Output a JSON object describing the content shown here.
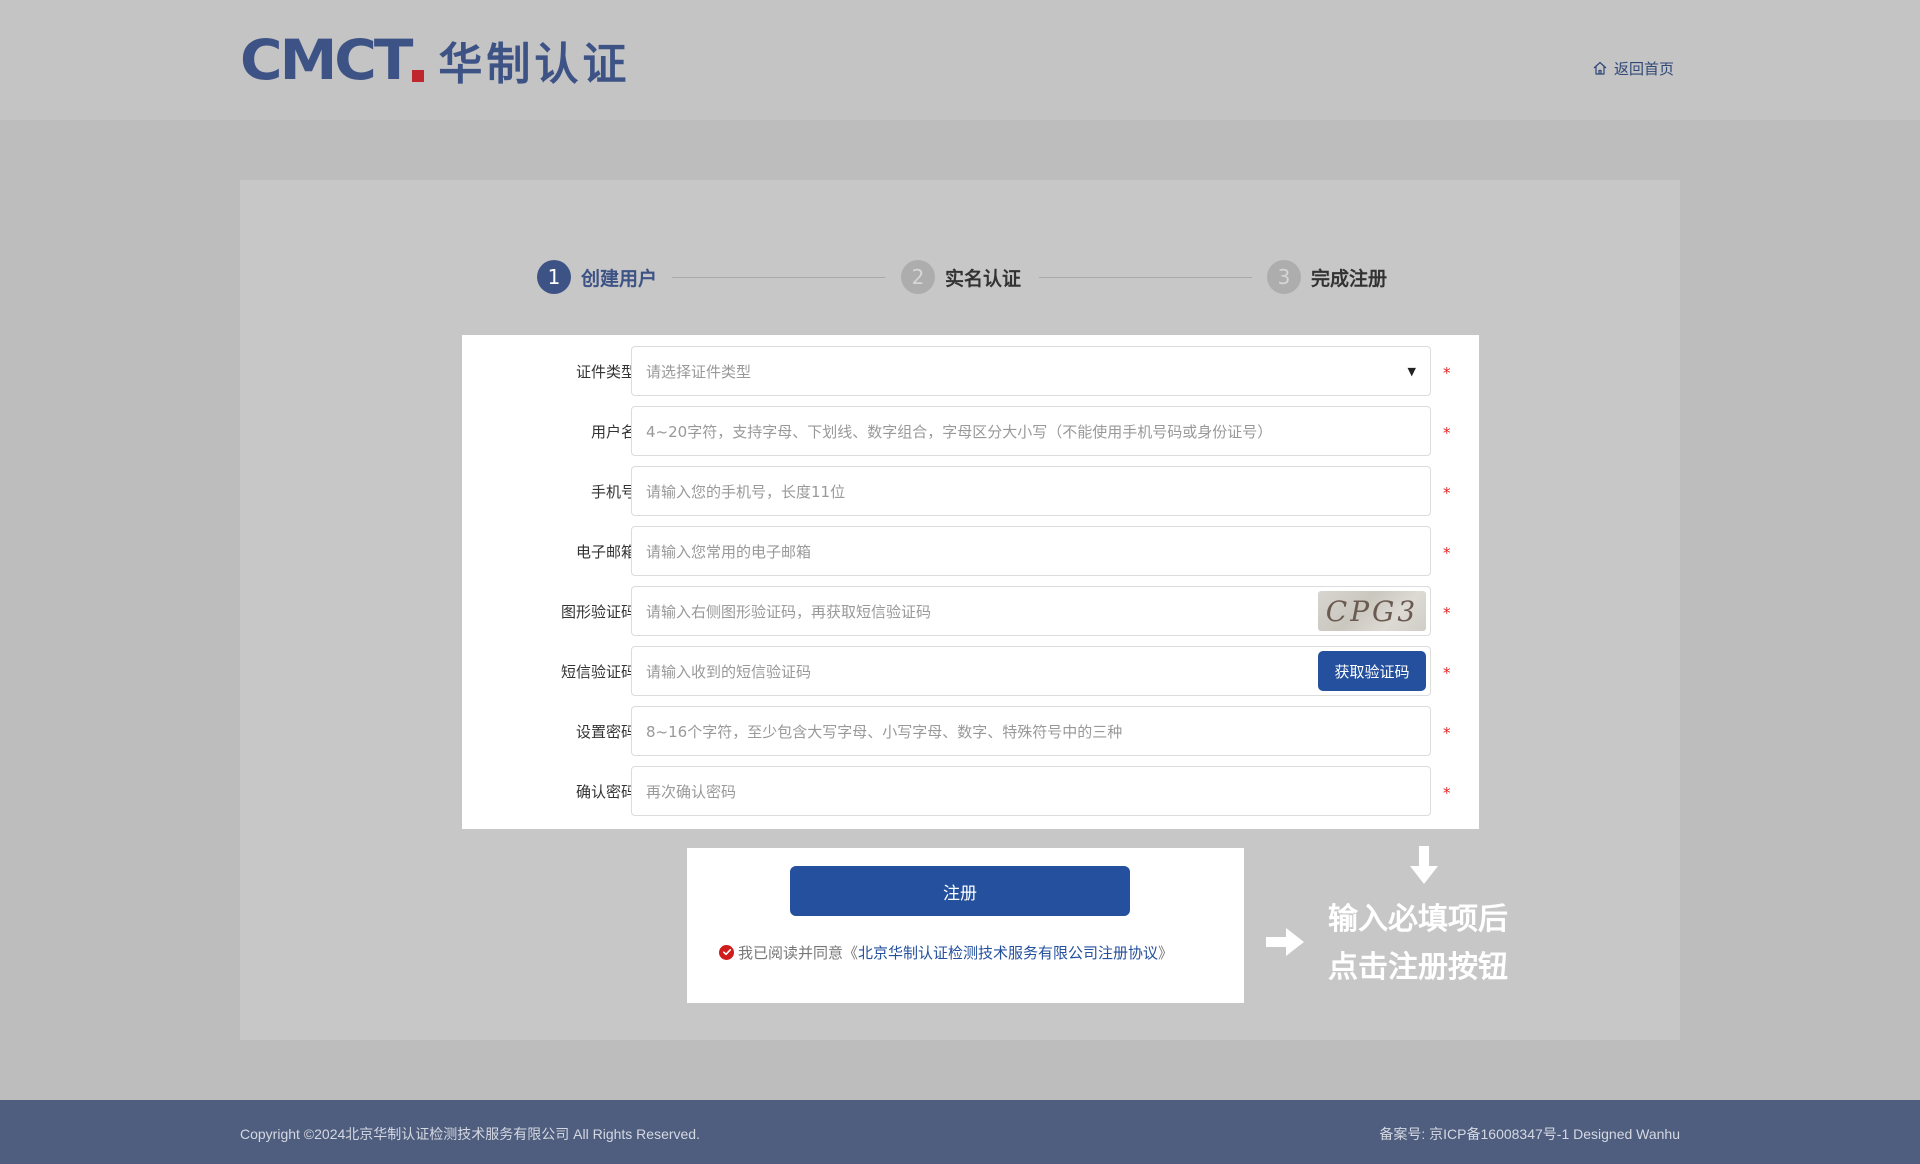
{
  "header": {
    "logo_mark": "CMCT",
    "logo_text": "华制认证",
    "home_link": "返回首页"
  },
  "steps": [
    {
      "num": "1",
      "label": "创建用户",
      "state": "active"
    },
    {
      "num": "2",
      "label": "实名认证",
      "state": "inactive"
    },
    {
      "num": "3",
      "label": "完成注册",
      "state": "inactive"
    }
  ],
  "form": {
    "required_mark": "*",
    "fields": [
      {
        "label": "证件类型:",
        "placeholder": "请选择证件类型",
        "type": "select"
      },
      {
        "label": "用户名:",
        "placeholder": "4~20字符，支持字母、下划线、数字组合，字母区分大小写（不能使用手机号码或身份证号）",
        "type": "text"
      },
      {
        "label": "手机号:",
        "placeholder": "请输入您的手机号，长度11位",
        "type": "text"
      },
      {
        "label": "电子邮箱:",
        "placeholder": "请输入您常用的电子邮箱",
        "type": "text"
      },
      {
        "label": "图形验证码:",
        "placeholder": "请输入右侧图形验证码，再获取短信验证码",
        "type": "captcha"
      },
      {
        "label": "短信验证码:",
        "placeholder": "请输入收到的短信验证码",
        "type": "sms"
      },
      {
        "label": "设置密码:",
        "placeholder": "8~16个字符，至少包含大写字母、小写字母、数字、特殊符号中的三种",
        "type": "password"
      },
      {
        "label": "确认密码:",
        "placeholder": "再次确认密码",
        "type": "password"
      }
    ],
    "captcha_text": "CPG3",
    "sms_button": "获取验证码"
  },
  "submit": {
    "register_button": "注册",
    "agree_prefix": "我已阅读并同意《",
    "agree_link": "北京华制认证检测技术服务有限公司注册协议",
    "agree_suffix": "》"
  },
  "hint": {
    "line1": "输入必填项后",
    "line2": "点击注册按钮"
  },
  "footer": {
    "copyright": "Copyright ©2024北京华制认证检测技术服务有限公司 All Rights Reserved.",
    "icp": "备案号: 京ICP备16008347号-1 Designed Wanhu"
  },
  "colors": {
    "brand": "#3e5385",
    "button": "#24509e",
    "required": "#e02020",
    "footer_bg": "#4f5e7e"
  },
  "icons": {
    "home": "home-icon",
    "select_caret": "caret-down-icon",
    "check": "check-circle-icon",
    "arrow_right": "arrow-right-icon",
    "arrow_down": "arrow-down-icon"
  }
}
